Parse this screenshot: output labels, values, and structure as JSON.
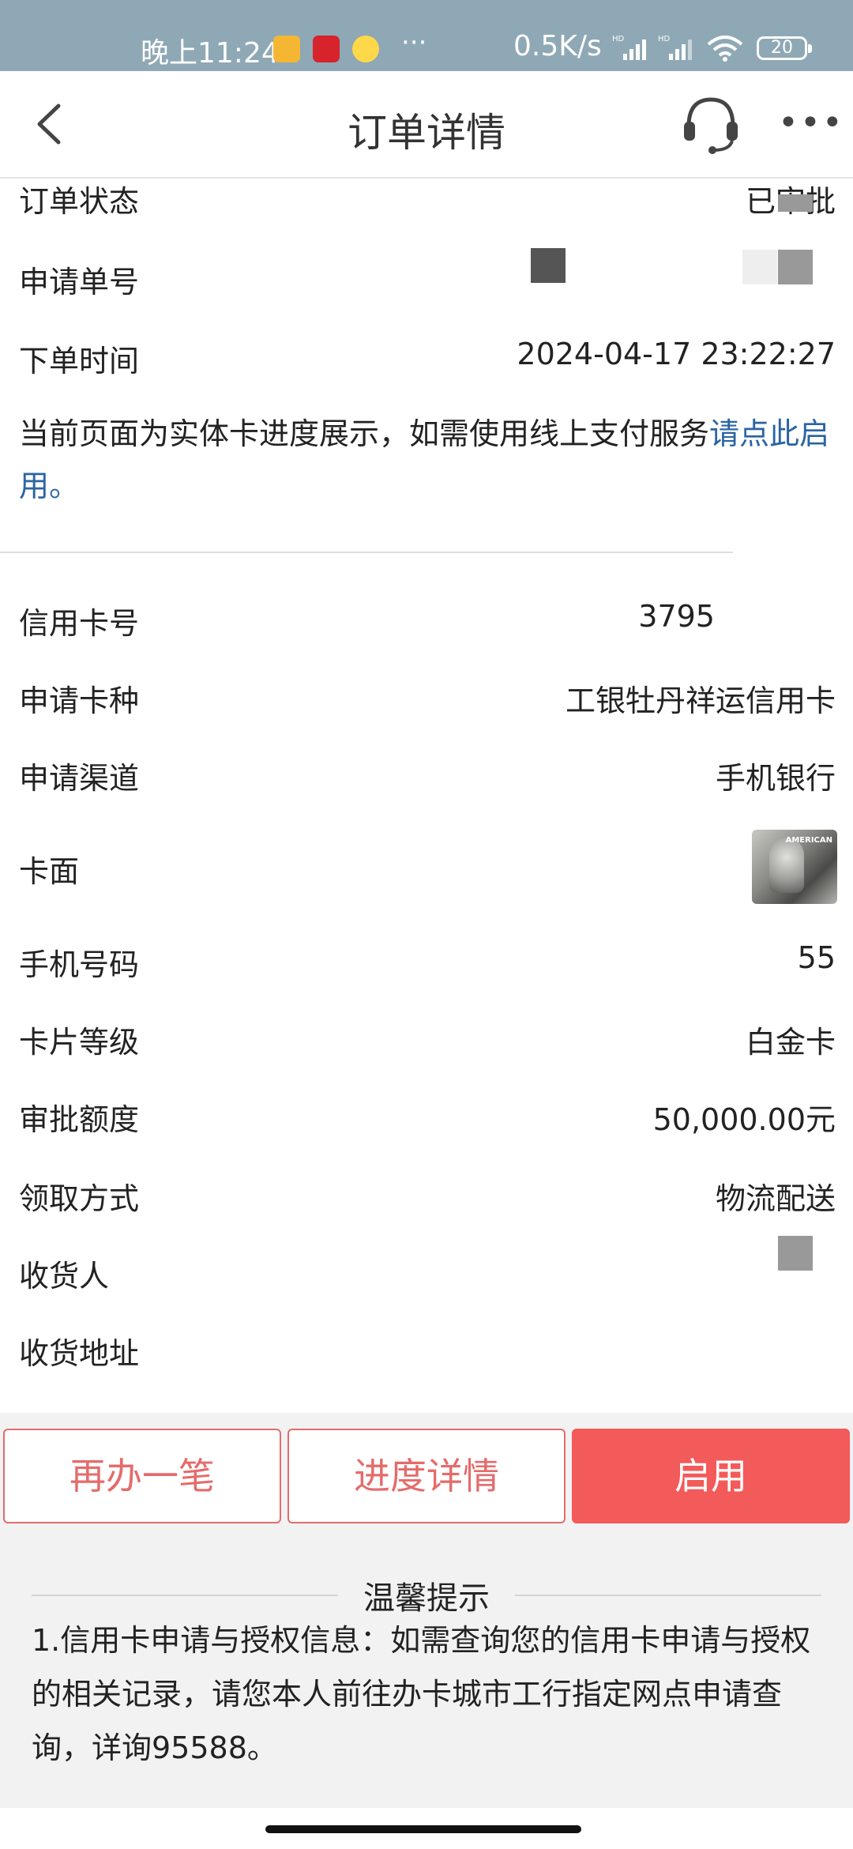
{
  "status_bar": {
    "time": "晚上11:24",
    "dots": "···",
    "speed": "0.5K/s",
    "battery": "20"
  },
  "header": {
    "title": "订单详情"
  },
  "order": {
    "status_label": "订单状态",
    "status_value": "已审批",
    "app_no_label": "申请单号",
    "time_label": "下单时间",
    "time_value": "2024-04-17 23:22:27"
  },
  "notice": {
    "text": "当前页面为实体卡进度展示，如需使用线上支付服务",
    "link": "请点此启用",
    "end": "。"
  },
  "card": {
    "card_no_label": "信用卡号",
    "card_no_value": "3795",
    "type_label": "申请卡种",
    "type_value": "工银牡丹祥运信用卡",
    "channel_label": "申请渠道",
    "channel_value": "手机银行",
    "face_label": "卡面",
    "face_brand": "AMERICAN",
    "phone_label": "手机号码",
    "phone_value": "55",
    "level_label": "卡片等级",
    "level_value": "白金卡",
    "limit_label": "审批额度",
    "limit_value": "50,000.00元",
    "delivery_label": "领取方式",
    "delivery_value": "物流配送",
    "receiver_label": "收货人",
    "address_label": "收货地址"
  },
  "actions": {
    "again": "再办一笔",
    "progress": "进度详情",
    "activate": "启用"
  },
  "tips": {
    "title": "温馨提示",
    "text": "1.信用卡申请与授权信息：如需查询您的信用卡申请与授权的相关记录，请您本人前往办卡城市工行指定网点申请查询，详询95588。"
  },
  "colors": {
    "link": "#2a64a4",
    "primary": "#f35a5a",
    "outline": "#e56b6b"
  }
}
